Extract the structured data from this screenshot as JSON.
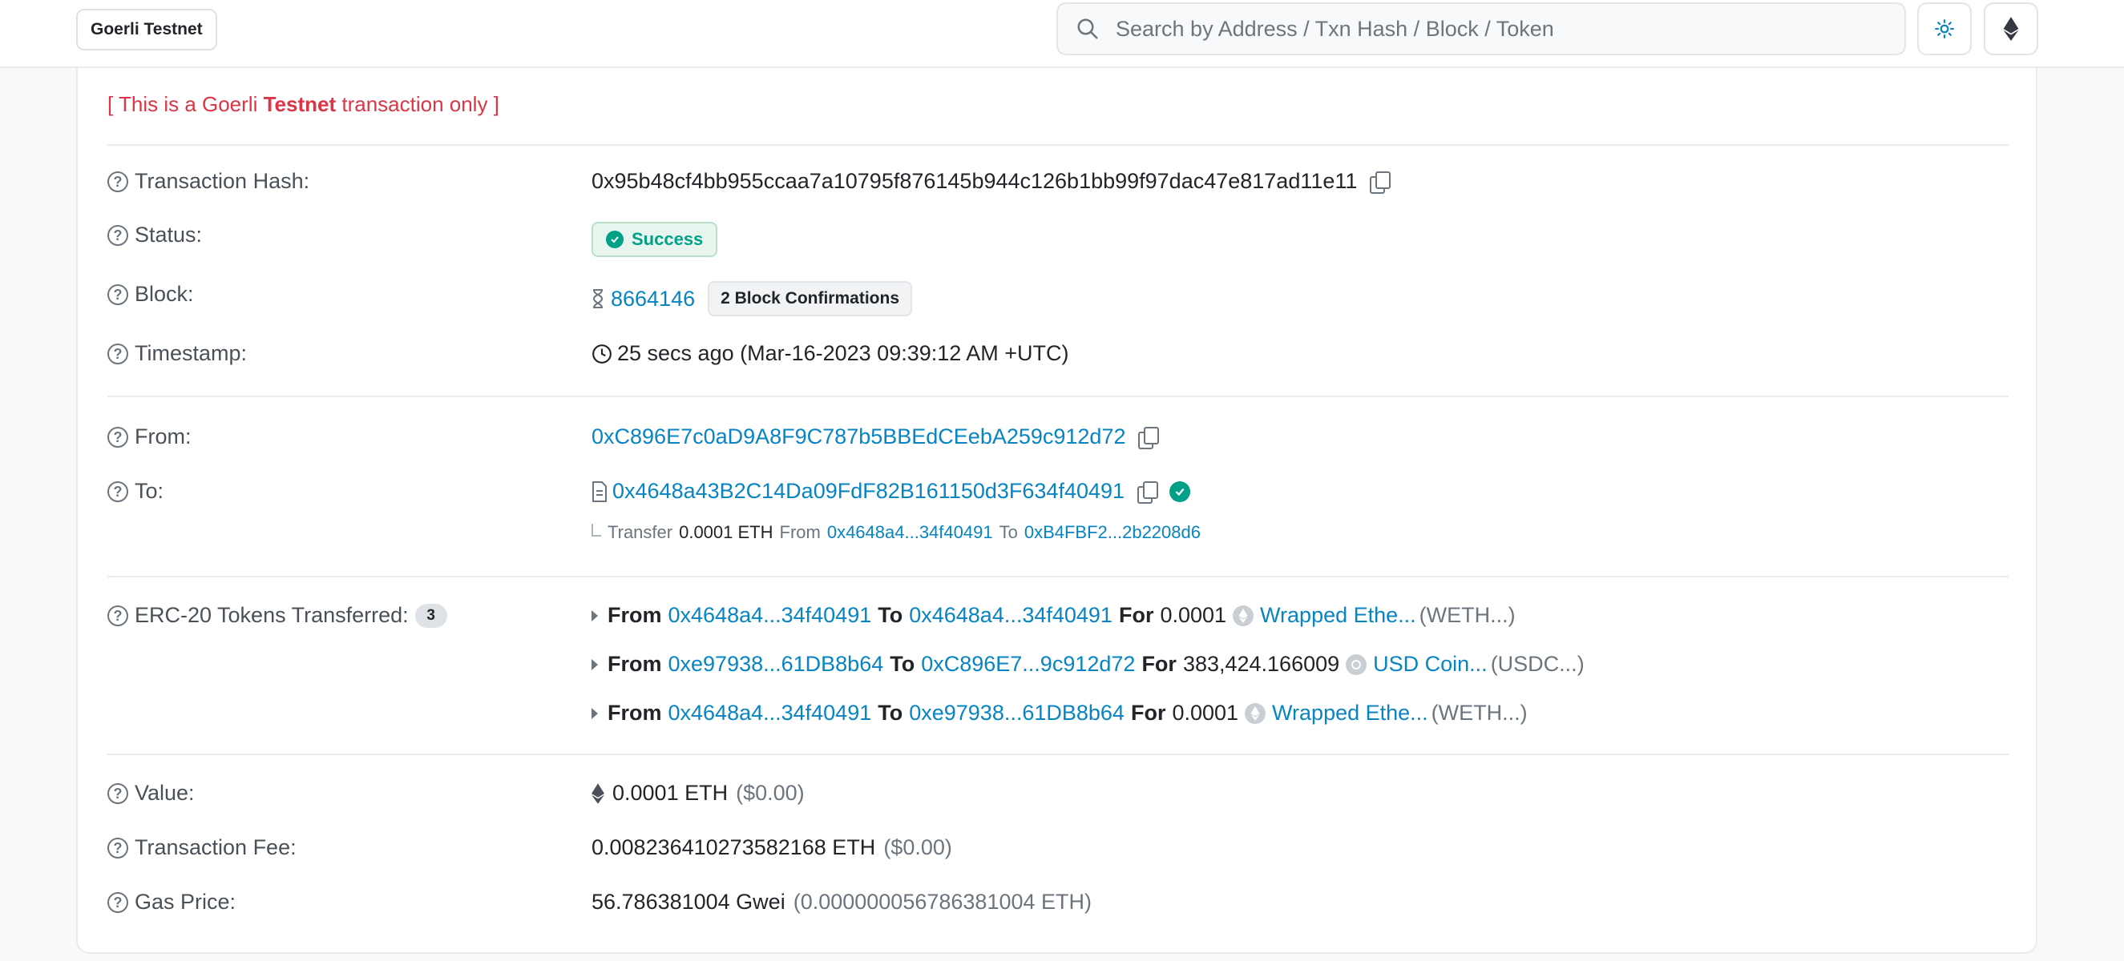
{
  "header": {
    "network_label": "Goerli Testnet",
    "search_placeholder": "Search by Address / Txn Hash / Block / Token",
    "icons": {
      "search": "search-icon",
      "theme": "sun-icon",
      "network": "ethereum-icon"
    }
  },
  "banner": {
    "prefix": "[ This is a Goerli ",
    "bold": "Testnet",
    "suffix": " transaction only ]"
  },
  "tx": {
    "hash_label": "Transaction Hash:",
    "hash": "0x95b48cf4bb955ccaa7a10795f876145b944c126b1bb99f97dac47e817ad11e11",
    "status_label": "Status:",
    "status": "Success",
    "block_label": "Block:",
    "block": "8664146",
    "confirmations": "2 Block Confirmations",
    "timestamp_label": "Timestamp:",
    "timestamp": "25 secs ago (Mar-16-2023 09:39:12 AM +UTC)",
    "from_label": "From:",
    "from": "0xC896E7c0aD9A8F9C787b5BBEdCEebA259c912d72",
    "to_label": "To:",
    "to": "0x4648a43B2C14Da09FdF82B161150d3F634f40491",
    "internal": {
      "transfer_word": "Transfer",
      "amount": "0.0001 ETH",
      "from_word": "From",
      "from": "0x4648a4...34f40491",
      "to_word": "To",
      "to": "0xB4FBF2...2b2208d6"
    },
    "erc20_label": "ERC-20 Tokens Transferred:",
    "erc20_count": "3",
    "erc20_words": {
      "from": "From",
      "to": "To",
      "for": "For"
    },
    "erc20": [
      {
        "from": "0x4648a4...34f40491",
        "to": "0x4648a4...34f40491",
        "amount": "0.0001",
        "token": "Wrapped Ethe...",
        "symbol": "(WETH...)"
      },
      {
        "from": "0xe97938...61DB8b64",
        "to": "0xC896E7...9c912d72",
        "amount": "383,424.166009",
        "token": "USD Coin...",
        "symbol": "(USDC...)"
      },
      {
        "from": "0x4648a4...34f40491",
        "to": "0xe97938...61DB8b64",
        "amount": "0.0001",
        "token": "Wrapped Ethe...",
        "symbol": "(WETH...)"
      }
    ],
    "value_label": "Value:",
    "value": "0.0001 ETH",
    "value_usd": "($0.00)",
    "fee_label": "Transaction Fee:",
    "fee": "0.008236410273582168 ETH",
    "fee_usd": "($0.00)",
    "gas_label": "Gas Price:",
    "gas": "56.786381004 Gwei",
    "gas_eth": "(0.000000056786381004 ETH)"
  },
  "colors": {
    "link": "#0784c3",
    "success": "#00a186",
    "warning": "#dc3545"
  }
}
